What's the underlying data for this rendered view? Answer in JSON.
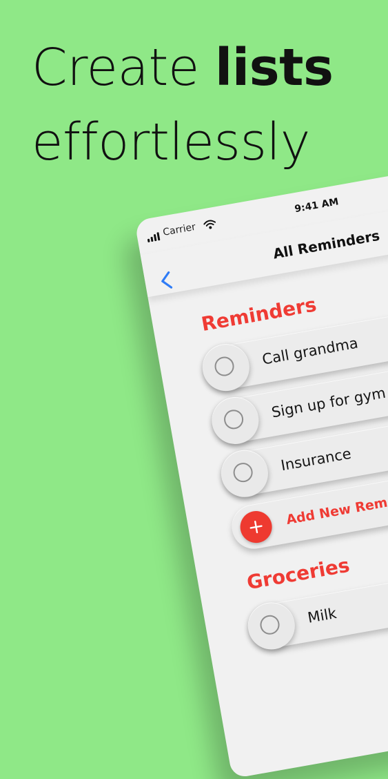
{
  "headline": {
    "line1_prefix": "Create ",
    "line1_bold": "lists",
    "line2": "effortlessly"
  },
  "status_bar": {
    "carrier": "Carrier",
    "time": "9:41 AM"
  },
  "nav": {
    "title": "All Reminders",
    "back_icon": "chevron-left-icon"
  },
  "sections": {
    "reminders": {
      "title": "Reminders",
      "items": [
        "Call grandma",
        "Sign up for gym",
        "Insurance"
      ],
      "add_label": "Add New Rem"
    },
    "groceries": {
      "title": "Groceries",
      "items": [
        "Milk"
      ]
    }
  },
  "colors": {
    "background": "#8fe887",
    "accent_red": "#ef3b34",
    "back_blue": "#2f7cf6"
  }
}
